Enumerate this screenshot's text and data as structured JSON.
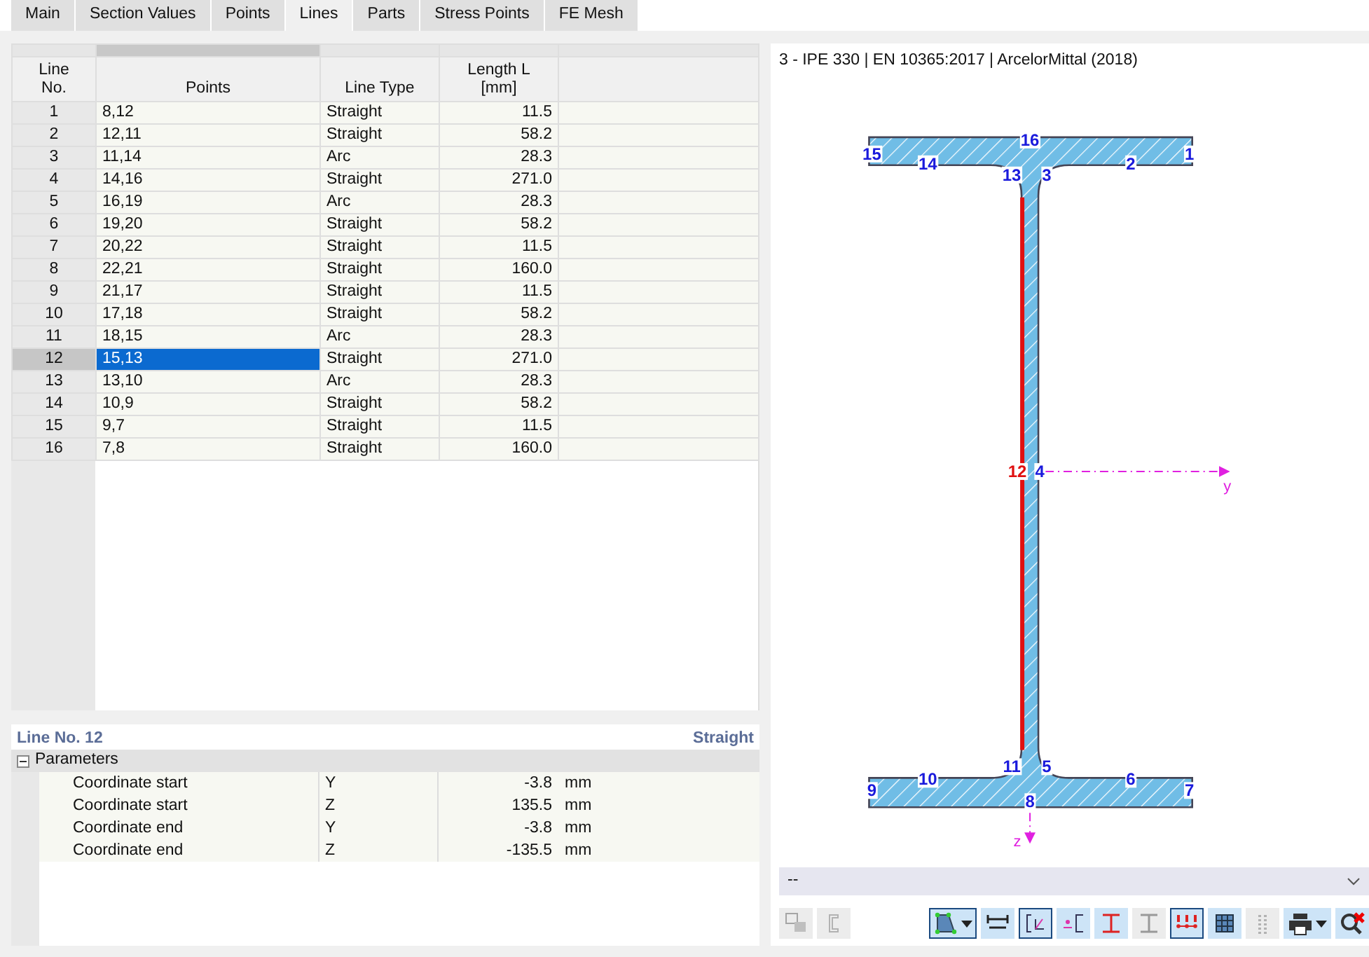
{
  "tabs": [
    {
      "label": "Main",
      "selected": false
    },
    {
      "label": "Section Values",
      "selected": false
    },
    {
      "label": "Points",
      "selected": false
    },
    {
      "label": "Lines",
      "selected": true
    },
    {
      "label": "Parts",
      "selected": false
    },
    {
      "label": "Stress Points",
      "selected": false
    },
    {
      "label": "FE Mesh",
      "selected": false
    }
  ],
  "table": {
    "columns": [
      {
        "label": "Line No."
      },
      {
        "label": "Points"
      },
      {
        "label": "Line Type"
      },
      {
        "label": "Length L [mm]"
      }
    ],
    "rows": [
      {
        "no": "1",
        "points": "8,12",
        "type": "Straight",
        "length": "11.5",
        "selected": false
      },
      {
        "no": "2",
        "points": "12,11",
        "type": "Straight",
        "length": "58.2",
        "selected": false
      },
      {
        "no": "3",
        "points": "11,14",
        "type": "Arc",
        "length": "28.3",
        "selected": false
      },
      {
        "no": "4",
        "points": "14,16",
        "type": "Straight",
        "length": "271.0",
        "selected": false
      },
      {
        "no": "5",
        "points": "16,19",
        "type": "Arc",
        "length": "28.3",
        "selected": false
      },
      {
        "no": "6",
        "points": "19,20",
        "type": "Straight",
        "length": "58.2",
        "selected": false
      },
      {
        "no": "7",
        "points": "20,22",
        "type": "Straight",
        "length": "11.5",
        "selected": false
      },
      {
        "no": "8",
        "points": "22,21",
        "type": "Straight",
        "length": "160.0",
        "selected": false
      },
      {
        "no": "9",
        "points": "21,17",
        "type": "Straight",
        "length": "11.5",
        "selected": false
      },
      {
        "no": "10",
        "points": "17,18",
        "type": "Straight",
        "length": "58.2",
        "selected": false
      },
      {
        "no": "11",
        "points": "18,15",
        "type": "Arc",
        "length": "28.3",
        "selected": false
      },
      {
        "no": "12",
        "points": "15,13",
        "type": "Straight",
        "length": "271.0",
        "selected": true
      },
      {
        "no": "13",
        "points": "13,10",
        "type": "Arc",
        "length": "28.3",
        "selected": false
      },
      {
        "no": "14",
        "points": "10,9",
        "type": "Straight",
        "length": "58.2",
        "selected": false
      },
      {
        "no": "15",
        "points": "9,7",
        "type": "Straight",
        "length": "11.5",
        "selected": false
      },
      {
        "no": "16",
        "points": "7,8",
        "type": "Straight",
        "length": "160.0",
        "selected": false
      }
    ]
  },
  "details": {
    "title": "Line No. 12",
    "type": "Straight",
    "group": {
      "label": "Parameters",
      "expanded": true
    },
    "rows": [
      {
        "name": "Coordinate start",
        "axis": "Y",
        "value": "-3.8",
        "unit": "mm"
      },
      {
        "name": "Coordinate start",
        "axis": "Z",
        "value": "135.5",
        "unit": "mm"
      },
      {
        "name": "Coordinate end",
        "axis": "Y",
        "value": "-3.8",
        "unit": "mm"
      },
      {
        "name": "Coordinate end",
        "axis": "Z",
        "value": "-135.5",
        "unit": "mm"
      }
    ]
  },
  "section": {
    "title": "3 - IPE 330 | EN 10365:2017 | ArcelorMittal (2018)",
    "points": [
      {
        "label": "1",
        "color": "#1a1adc"
      },
      {
        "label": "2",
        "color": "#1a1adc"
      },
      {
        "label": "3",
        "color": "#1a1adc"
      },
      {
        "label": "13",
        "color": "#1a1adc"
      },
      {
        "label": "14",
        "color": "#1a1adc"
      },
      {
        "label": "15",
        "color": "#1a1adc"
      },
      {
        "label": "16",
        "color": "#1a1adc"
      },
      {
        "label": "12",
        "color": "#e01010"
      },
      {
        "label": "4",
        "color": "#1a1adc"
      },
      {
        "label": "9",
        "color": "#1a1adc"
      },
      {
        "label": "10",
        "color": "#1a1adc"
      },
      {
        "label": "11",
        "color": "#1a1adc"
      },
      {
        "label": "5",
        "color": "#1a1adc"
      },
      {
        "label": "6",
        "color": "#1a1adc"
      },
      {
        "label": "7",
        "color": "#1a1adc"
      },
      {
        "label": "8",
        "color": "#1a1adc"
      }
    ],
    "axes": [
      {
        "label": "y"
      },
      {
        "label": "z"
      }
    ],
    "dropdown": {
      "value": "--"
    }
  },
  "toolbar": [
    {
      "kind": "swap",
      "disabled": true,
      "pressed": false,
      "menu": false
    },
    {
      "kind": "rotate",
      "disabled": true,
      "pressed": false,
      "menu": false
    },
    {
      "kind": "shape",
      "disabled": false,
      "pressed": true,
      "menu": true
    },
    {
      "kind": "dimension",
      "disabled": false,
      "pressed": false,
      "menu": false
    },
    {
      "kind": "axes",
      "disabled": false,
      "pressed": true,
      "menu": false
    },
    {
      "kind": "shear",
      "disabled": false,
      "pressed": false,
      "menu": false
    },
    {
      "kind": "ibeam",
      "disabled": false,
      "pressed": false,
      "menu": false
    },
    {
      "kind": "ibeam",
      "disabled": true,
      "pressed": false,
      "menu": false
    },
    {
      "kind": "numbers",
      "disabled": false,
      "pressed": true,
      "menu": false
    },
    {
      "kind": "grid",
      "disabled": false,
      "pressed": false,
      "menu": false
    },
    {
      "kind": "dots",
      "disabled": true,
      "pressed": false,
      "menu": false
    },
    {
      "kind": "print",
      "disabled": false,
      "pressed": false,
      "menu": true
    },
    {
      "kind": "reset",
      "disabled": false,
      "pressed": false,
      "menu": false
    }
  ]
}
